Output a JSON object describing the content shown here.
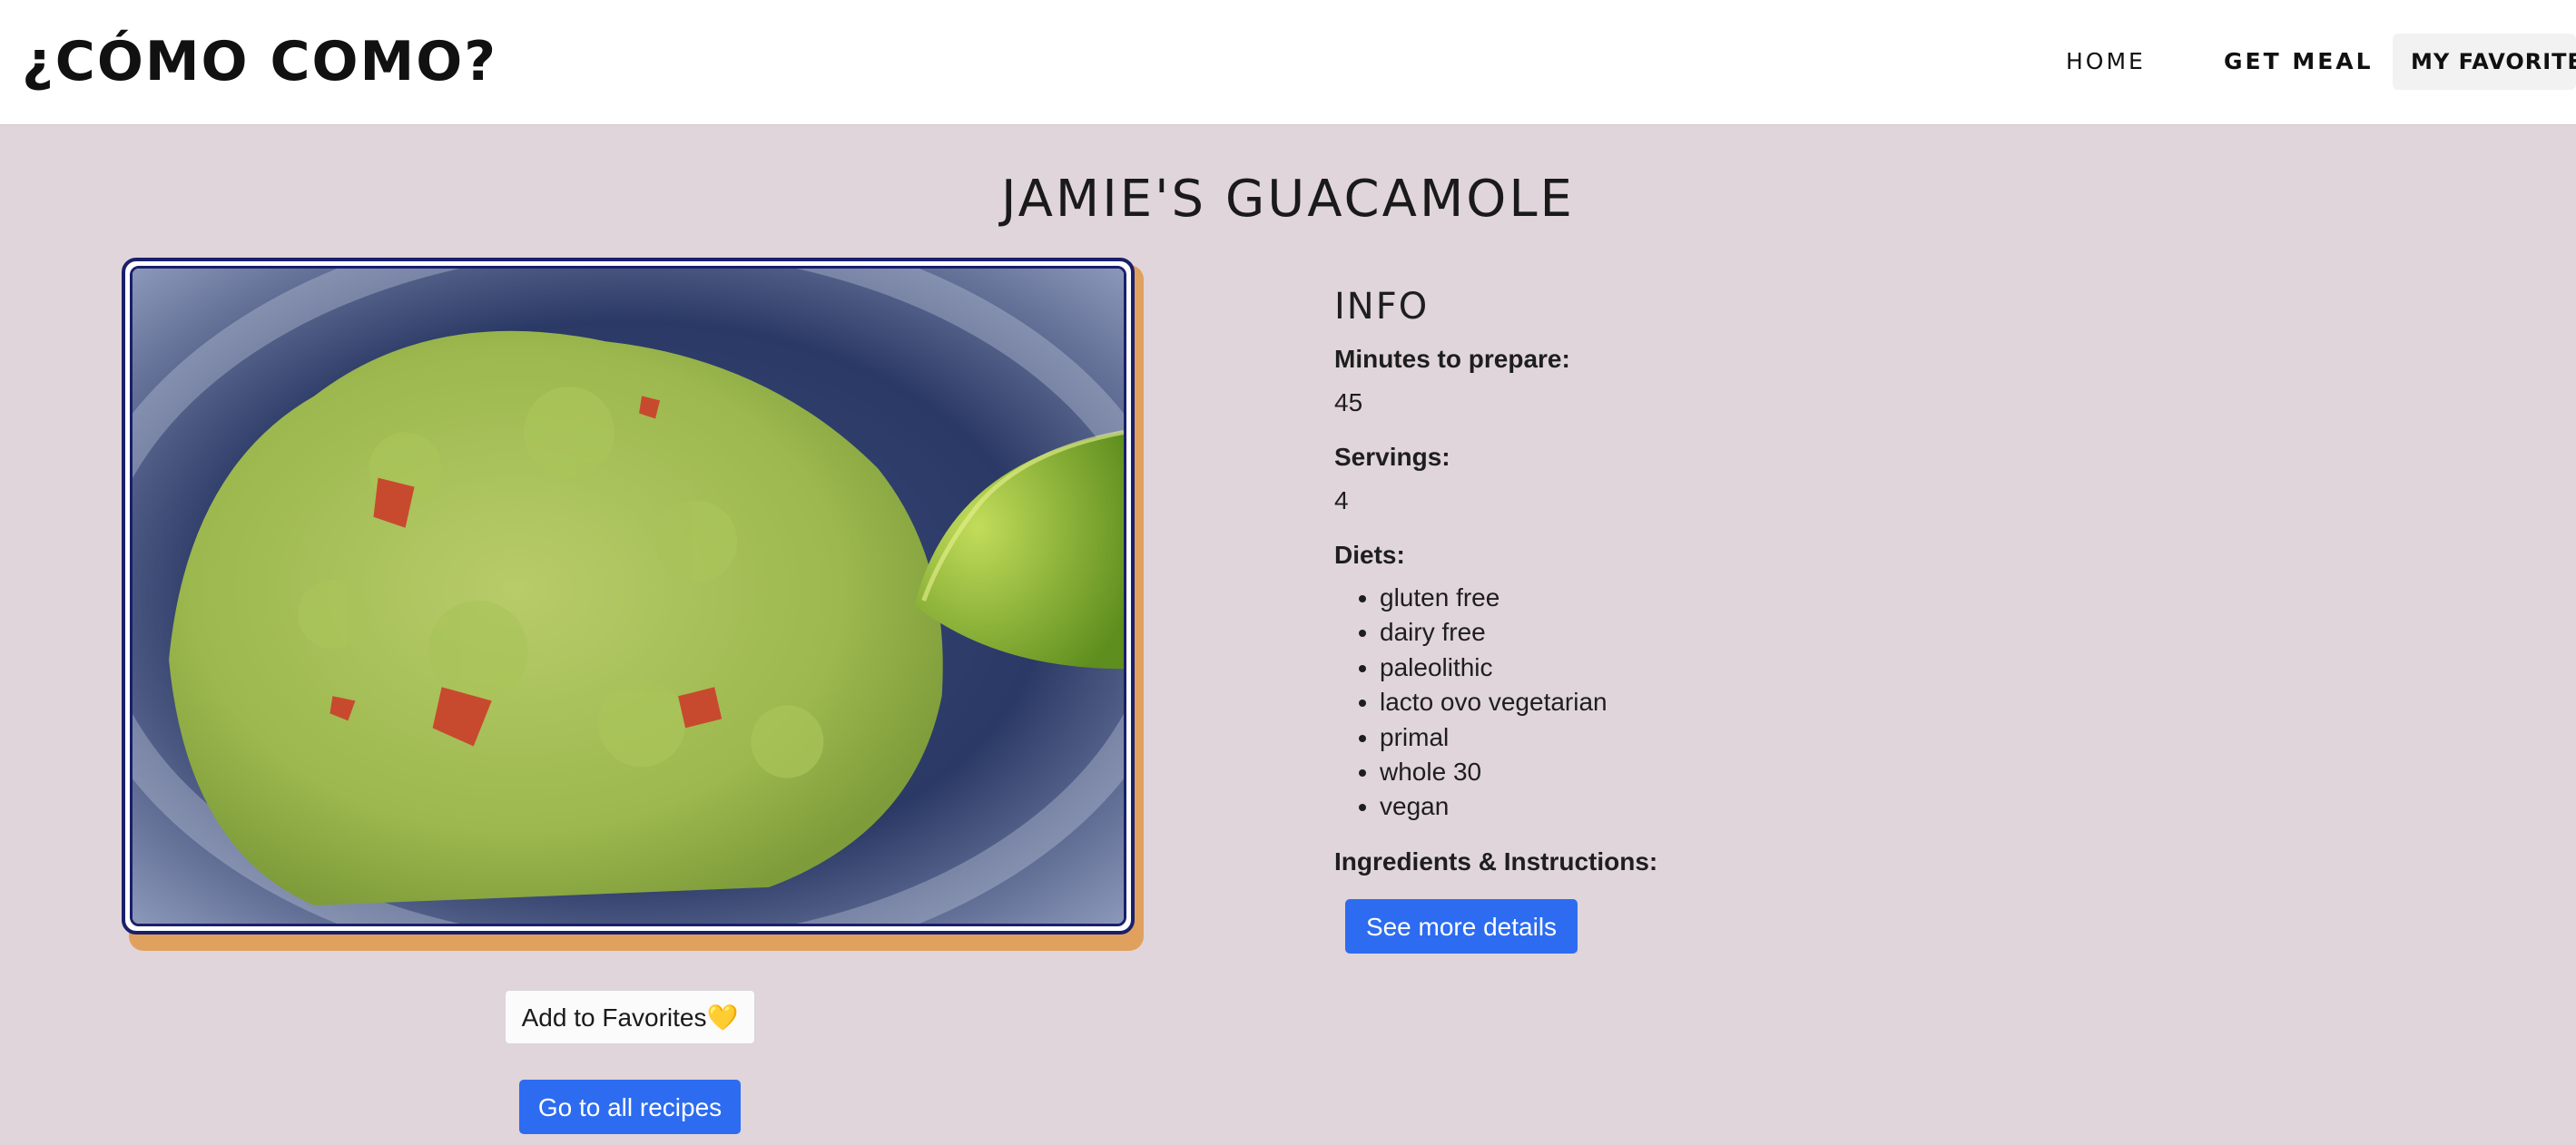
{
  "header": {
    "logo": "¿CÓMO COMO?",
    "nav": {
      "home": "HOME",
      "get_meal": "GET MEAL",
      "favorites": "MY FAVORITES 💛"
    }
  },
  "recipe": {
    "title": "Jamie's Guacamole",
    "image_alt": "guacamole in a blue bowl with a lime wedge"
  },
  "info": {
    "heading": "INFO",
    "minutes_label": "Minutes to prepare:",
    "minutes_value": "45",
    "servings_label": "Servings:",
    "servings_value": "4",
    "diets_label": "Diets:",
    "diets": [
      "gluten free",
      "dairy free",
      "paleolithic",
      "lacto ovo vegetarian",
      "primal",
      "whole 30",
      "vegan"
    ],
    "ingredients_label": "Ingredients & Instructions:",
    "details_button": "See more details"
  },
  "actions": {
    "add_favorites": "Add to Favorites💛",
    "all_recipes": "Go to all recipes"
  },
  "colors": {
    "page_bg": "#e0d5da",
    "primary": "#2d6cf0",
    "photo_shadow": "#e0a15e",
    "photo_border": "#1a1f6b"
  }
}
